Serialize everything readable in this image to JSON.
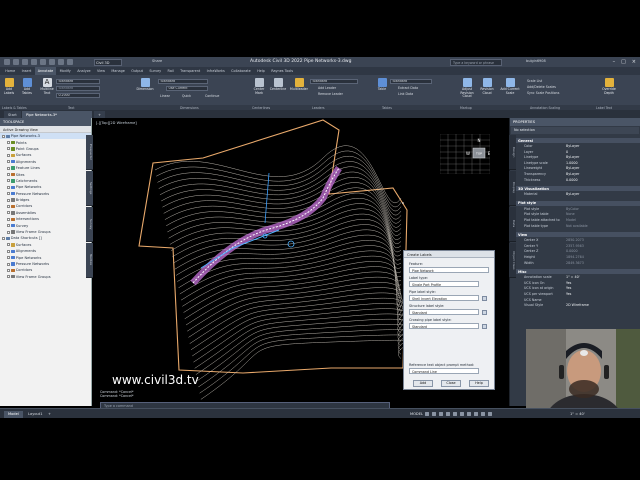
{
  "app": {
    "title": "Autodesk Civil 3D 2022   Pipe Networks-3.dwg",
    "workspace": "Civil 3D",
    "share_label": "Share",
    "search_placeholder": "Type a keyword or phrase",
    "user": "bulgin6908"
  },
  "ribbon": {
    "tabs": [
      "Home",
      "Insert",
      "Annotate",
      "Modify",
      "Analyze",
      "View",
      "Manage",
      "Output",
      "Survey",
      "Rail",
      "Transparent",
      "InfraWorks",
      "Collaborate",
      "Help",
      "Raynes Tools"
    ],
    "active_tab": "Annotate",
    "buttons": {
      "add_labels": "Add Labels",
      "add_tables": "Add Tables",
      "multiline_text": "Multiline Text",
      "dimension": "Dimension",
      "leader": "Leader",
      "center_mark": "Center Mark",
      "centerline": "Centerline",
      "multileader": "Multileader",
      "table": "Table",
      "add_leader": "Add Leader",
      "remove_leader": "Remove Leader",
      "extract_data": "Extract Data",
      "link_data": "Link Data",
      "adjust_revision_cloud": "Adjust Revision Cloud",
      "revision_cloud": "Revision Cloud",
      "add_current_scale": "Add Current Scale",
      "overrideenyu": "Override Depth"
    },
    "dropdowns": {
      "text_style": "Standard",
      "dim_style": "Standard",
      "ml_style": "Standard",
      "table_style": "Standard",
      "layer": "Use Current",
      "text_height": "0.2000",
      "scale": "Standard"
    },
    "small_labels": {
      "linear": "Linear",
      "quick": "Quick",
      "continue": "Continue",
      "scale_list": "Scale List",
      "add_delete_scales": "Add/Delete Scales",
      "sync_scale_positions": "Sync Scale Positions"
    },
    "panels": [
      "Labels & Tables",
      "Text",
      "Dimensions",
      "Centerlines",
      "Leaders",
      "Tables",
      "Markup",
      "Annotation Scaling",
      "Label Text"
    ]
  },
  "file_tabs": {
    "start": "Start",
    "active": "Pipe Networks-3*",
    "add": "+"
  },
  "toolspace": {
    "title": "TOOLSPACE",
    "view": "Active Drawing View",
    "items": [
      {
        "label": "Pipe Networks-3",
        "level": 0,
        "color": "#5e7ea8"
      },
      {
        "label": "Points",
        "level": 1,
        "color": "#6b8e23"
      },
      {
        "label": "Point Groups",
        "level": 1,
        "color": "#6b8e23"
      },
      {
        "label": "Surfaces",
        "level": 1,
        "color": "#c8a03c"
      },
      {
        "label": "Alignments",
        "level": 1,
        "color": "#4a7bd0"
      },
      {
        "label": "Feature Lines",
        "level": 1,
        "color": "#3b9c6e"
      },
      {
        "label": "Sites",
        "level": 1,
        "color": "#b86f2e"
      },
      {
        "label": "Catchments",
        "level": 1,
        "color": "#3b9c6e"
      },
      {
        "label": "Pipe Networks",
        "level": 1,
        "color": "#4a7bd0"
      },
      {
        "label": "Pressure Networks",
        "level": 1,
        "color": "#4a7bd0"
      },
      {
        "label": "Bridges",
        "level": 1,
        "color": "#777"
      },
      {
        "label": "Corridors",
        "level": 1,
        "color": "#b86f2e"
      },
      {
        "label": "Assemblies",
        "level": 1,
        "color": "#777"
      },
      {
        "label": "Intersections",
        "level": 1,
        "color": "#b86f2e"
      },
      {
        "label": "Survey",
        "level": 1,
        "color": "#4a7bd0"
      },
      {
        "label": "View Frame Groups",
        "level": 1,
        "color": "#777"
      },
      {
        "label": "Data Shortcuts []",
        "level": 0,
        "color": "#5e7ea8"
      },
      {
        "label": "Surfaces",
        "level": 1,
        "color": "#c8a03c"
      },
      {
        "label": "Alignments",
        "level": 1,
        "color": "#4a7bd0"
      },
      {
        "label": "Pipe Networks",
        "level": 1,
        "color": "#4a7bd0"
      },
      {
        "label": "Pressure Networks",
        "level": 1,
        "color": "#4a7bd0"
      },
      {
        "label": "Corridors",
        "level": 1,
        "color": "#b86f2e"
      },
      {
        "label": "View Frame Groups",
        "level": 1,
        "color": "#777"
      }
    ],
    "side_tabs": [
      "Prospector",
      "Settings",
      "Survey",
      "Toolbox"
    ]
  },
  "viewport": {
    "label": "[-][Top][2D Wireframe]",
    "viewcube_top": "TOP",
    "viewcube_n": "N",
    "viewcube_w": "W",
    "viewcube_e": "E",
    "watermark": "www.civil3d.tv"
  },
  "dialog": {
    "title": "Create Labels",
    "feature_label": "Feature:",
    "feature_value": "Pipe Network",
    "label_type_label": "Label type:",
    "label_type_value": "Single Part Profile",
    "pipe_label_style_label": "Pipe label style:",
    "pipe_label_style_value": "Shell Invert Elevation",
    "structure_label_style_label": "Structure label style:",
    "structure_label_style_value": "Standard",
    "crossing_label_style_label": "Crossing pipe label style:",
    "crossing_label_style_value": "Standard",
    "reference_label": "Reference text object prompt method:",
    "reference_value": "Command Line",
    "add": "Add",
    "close": "Close",
    "help": "Help"
  },
  "command": {
    "line1": "Command:  *Cancel*",
    "line2": "Command:  *Cancel*",
    "prompt": "Type a command"
  },
  "properties": {
    "title": "PROPERTIES",
    "selection": "No selection",
    "side_tabs": [
      "Design",
      "Display",
      "Data",
      "Object Class"
    ],
    "sections": [
      {
        "name": "General",
        "rows": [
          {
            "k": "Color",
            "v": "ByLayer"
          },
          {
            "k": "Layer",
            "v": "0"
          },
          {
            "k": "Linetype",
            "v": "ByLayer"
          },
          {
            "k": "Linetype scale",
            "v": "1.0000"
          },
          {
            "k": "Lineweight",
            "v": "ByLayer"
          },
          {
            "k": "Transparency",
            "v": "ByLayer"
          },
          {
            "k": "Thickness",
            "v": "0.0000"
          }
        ]
      },
      {
        "name": "3D Visualization",
        "rows": [
          {
            "k": "Material",
            "v": "ByLayer"
          }
        ]
      },
      {
        "name": "Plot style",
        "rows": [
          {
            "k": "Plot style",
            "v": "ByColor"
          },
          {
            "k": "Plot style table",
            "v": "None"
          },
          {
            "k": "Plot table attached to",
            "v": "Model"
          },
          {
            "k": "Plot table type",
            "v": "Not available"
          }
        ]
      },
      {
        "name": "View",
        "rows": [
          {
            "k": "Center X",
            "v": "2850.2073"
          },
          {
            "k": "Center Y",
            "v": "2357.9563"
          },
          {
            "k": "Center Z",
            "v": "0.0000"
          },
          {
            "k": "Height",
            "v": "1894.2764"
          },
          {
            "k": "Width",
            "v": "2849.3673"
          }
        ]
      },
      {
        "name": "Misc",
        "rows": [
          {
            "k": "Annotation scale",
            "v": "1\" = 40'"
          },
          {
            "k": "UCS icon On",
            "v": "Yes"
          },
          {
            "k": "UCS icon at origin",
            "v": "Yes"
          },
          {
            "k": "UCS per viewport",
            "v": "Yes"
          },
          {
            "k": "UCS Name",
            "v": ""
          },
          {
            "k": "Visual Style",
            "v": "2D Wireframe"
          }
        ]
      }
    ]
  },
  "status": {
    "layout_tabs": [
      "Model",
      "Layout1",
      "+"
    ],
    "active_layout": "Model",
    "model": "MODEL",
    "scale": "1\" = 40'"
  }
}
